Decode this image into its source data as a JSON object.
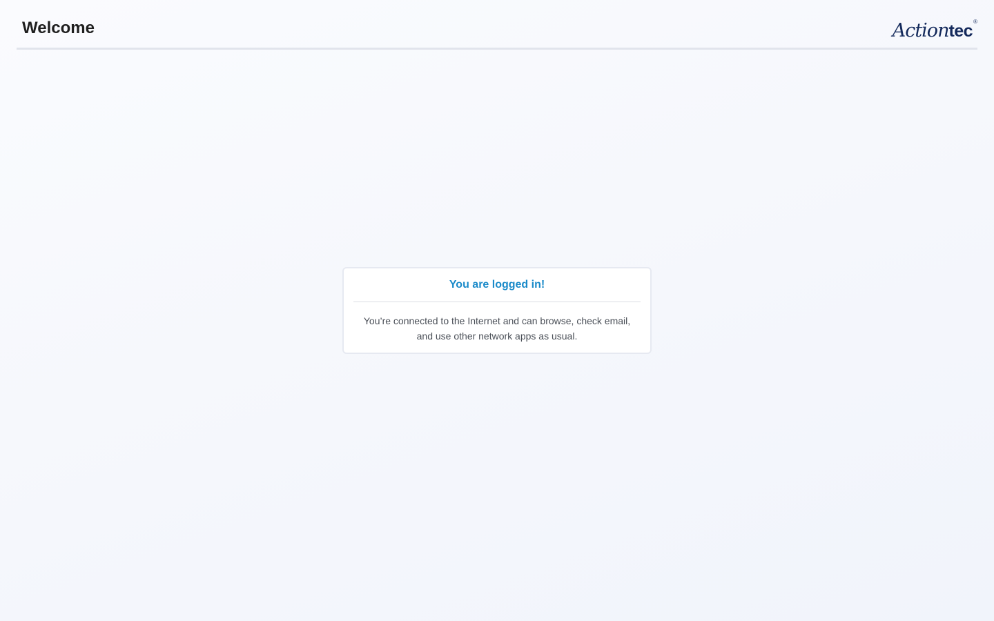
{
  "header": {
    "title": "Welcome",
    "logo": {
      "script_part": "Action",
      "bold_part": "tec",
      "registered_mark": "®",
      "color": "#13295b"
    }
  },
  "status_card": {
    "title": "You are logged in!",
    "message": "You’re connected to the Internet and can browse, check email, and use other network apps as usual.",
    "title_color": "#1a8ac9"
  }
}
